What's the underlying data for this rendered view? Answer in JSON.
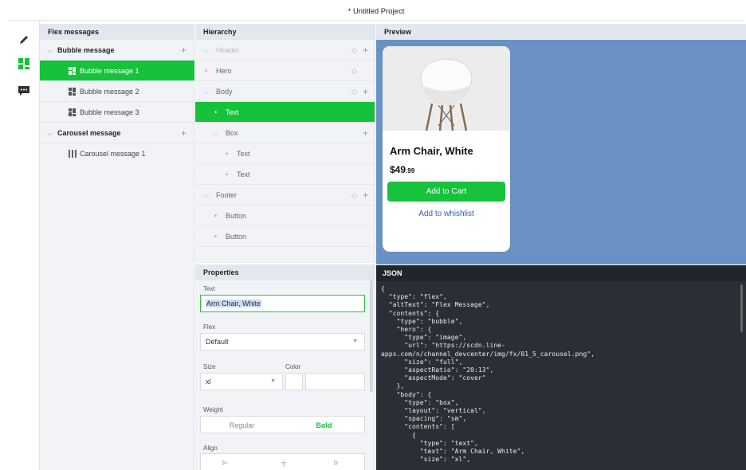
{
  "window": {
    "title": "* Untitled Project"
  },
  "toolbar": {
    "icons": [
      "pencil-icon",
      "grid-icon",
      "chat-icon"
    ],
    "accent": "#16c23a"
  },
  "flex_panel": {
    "title": "Flex messages",
    "groups": [
      {
        "label": "Bubble message",
        "items": [
          "Bubble message 1",
          "Bubble message 2",
          "Bubble message 3"
        ]
      },
      {
        "label": "Carousel message",
        "items": [
          "Carousel message 1"
        ]
      }
    ]
  },
  "hierarchy": {
    "title": "Hierarchy",
    "rows": [
      "Header",
      "Hero",
      "Body",
      "Text",
      "Box",
      "Text",
      "Text",
      "Footer",
      "Button",
      "Button"
    ]
  },
  "properties": {
    "title": "Properties",
    "text_label": "Text",
    "text_value": "Arm Chair, White",
    "flex_label": "Flex",
    "flex_value": "Default",
    "size_label": "Size",
    "size_value": "xl",
    "color_label": "Color",
    "weight_label": "Weight",
    "weight_regular": "Regular",
    "weight_bold": "Bold",
    "align_label": "Align"
  },
  "preview": {
    "title": "Preview",
    "background": "#6a91c4",
    "card": {
      "title": "Arm Chair, White",
      "price_main": "$49",
      "price_cents": ".99",
      "cart_button": "Add to Cart",
      "wishlist_link": "Add to whishlist"
    }
  },
  "json_panel": {
    "title": "JSON",
    "code": "{\n  \"type\": \"flex\",\n  \"altText\": \"Flex Message\",\n  \"contents\": {\n    \"type\": \"bubble\",\n    \"hero\": {\n      \"type\": \"image\",\n      \"url\": \"https://scdn.line-\napps.com/n/channel_devcenter/img/fx/01_5_carousel.png\",\n      \"size\": \"full\",\n      \"aspectRatio\": \"20:13\",\n      \"aspectMode\": \"cover\"\n    },\n    \"body\": {\n      \"type\": \"box\",\n      \"layout\": \"vertical\",\n      \"spacing\": \"sm\",\n      \"contents\": [\n        {\n          \"type\": \"text\",\n          \"text\": \"Arm Chair, White\",\n          \"size\": \"xl\","
  }
}
